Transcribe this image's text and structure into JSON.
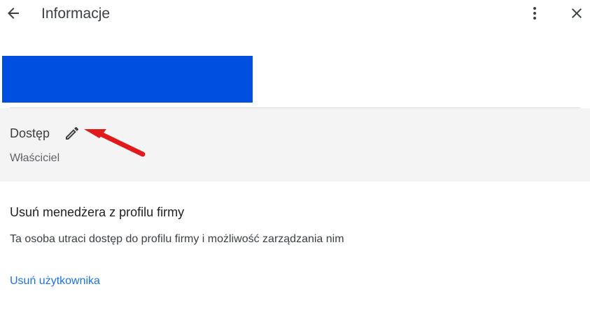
{
  "header": {
    "title": "Informacje",
    "back_icon": "arrow-back-icon",
    "more_icon": "more-vert-icon",
    "close_icon": "close-icon"
  },
  "redacted_block_color": "#004fe0",
  "access": {
    "label": "Dostęp",
    "edit_icon": "pencil-icon",
    "role": "Właściciel"
  },
  "annotation": {
    "arrow_color": "#e11b1b"
  },
  "remove_manager": {
    "title": "Usuń menedżera z profilu firmy",
    "description": "Ta osoba utraci dostęp do profilu firmy i możliwość zarządzania nim",
    "link_label": "Usuń użytkownika"
  }
}
